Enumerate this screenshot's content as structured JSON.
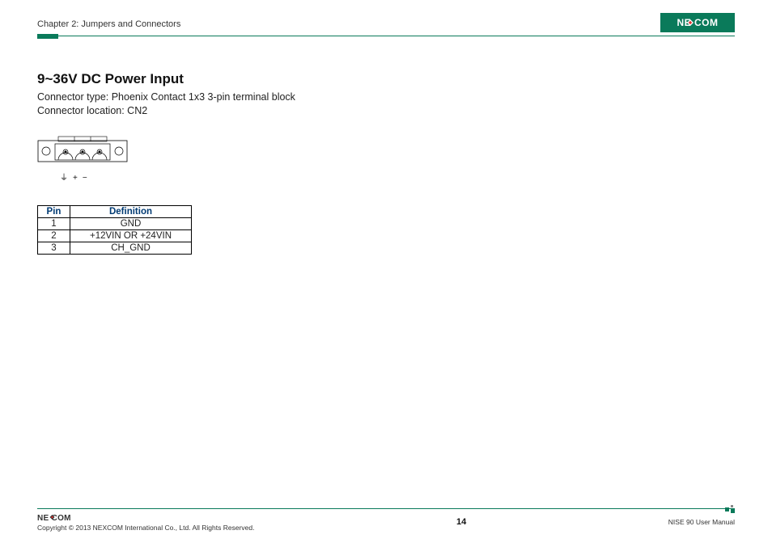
{
  "header": {
    "chapter": "Chapter 2: Jumpers and Connectors",
    "brand": "NEXCOM"
  },
  "section": {
    "title": "9~36V DC Power Input",
    "line1": "Connector type: Phoenix Contact 1x3 3-pin terminal block",
    "line2": "Connector location: CN2"
  },
  "diagram_labels": {
    "gnd_sym": "⏚",
    "plus": "+",
    "minus": "−"
  },
  "table": {
    "head_pin": "Pin",
    "head_def": "Definition",
    "rows": [
      {
        "pin": "1",
        "def": "GND"
      },
      {
        "pin": "2",
        "def": "+12VIN OR +24VIN"
      },
      {
        "pin": "3",
        "def": "CH_GND"
      }
    ]
  },
  "footer": {
    "brand": "NEXCOM",
    "copyright": "Copyright © 2013 NEXCOM International Co., Ltd. All Rights Reserved.",
    "page": "14",
    "manual": "NISE 90 User Manual"
  }
}
